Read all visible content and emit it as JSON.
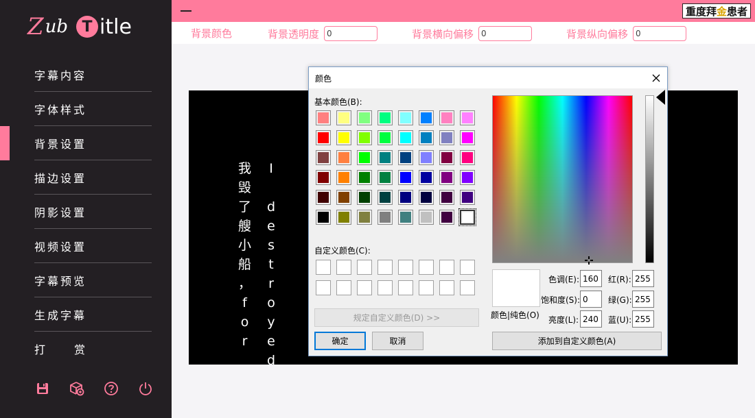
{
  "app": {
    "logo": {
      "z": "Z",
      "ub": "ub",
      "t": "T",
      "rest": "itle"
    },
    "watermark": {
      "pre": "重度",
      "mid": "拜",
      "gold": "金",
      "post": "患者"
    }
  },
  "sidebar": {
    "items": [
      {
        "label": "字幕内容"
      },
      {
        "label": "字体样式"
      },
      {
        "label": "背景设置",
        "active": true
      },
      {
        "label": "描边设置"
      },
      {
        "label": "阴影设置"
      },
      {
        "label": "视频设置"
      },
      {
        "label": "字幕预览"
      },
      {
        "label": "生成字幕"
      },
      {
        "label": "打赏"
      }
    ],
    "tools": [
      "save-icon",
      "package-icon",
      "help-icon",
      "power-icon"
    ],
    "accent": "#ff7b9c",
    "background": "#231f23"
  },
  "background_settings": {
    "color_label": "背景颜色",
    "opacity_label": "背景透明度",
    "opacity_value": "0",
    "x_offset_label": "背景横向偏移",
    "x_offset_value": "0",
    "y_offset_label": "背景纵向偏移",
    "y_offset_value": "0"
  },
  "preview": {
    "col1": [
      "我",
      "毁",
      "了",
      "艘",
      "小",
      "船",
      "，",
      "f",
      "o",
      "r"
    ],
    "col2": [
      "I",
      "",
      "d",
      "e",
      "s",
      "t",
      "r",
      "o",
      "y",
      "e",
      "d"
    ]
  },
  "color_dialog": {
    "title": "颜色",
    "basic_label": "基本颜色(B):",
    "basic_colors": [
      "#ff8080",
      "#ffff80",
      "#80ff80",
      "#00ff80",
      "#80ffff",
      "#0080ff",
      "#ff80c0",
      "#ff80ff",
      "#ff0000",
      "#ffff00",
      "#80ff00",
      "#00ff40",
      "#00ffff",
      "#0080c0",
      "#8080c0",
      "#ff00ff",
      "#804040",
      "#ff8040",
      "#00ff00",
      "#008080",
      "#004080",
      "#8080ff",
      "#800040",
      "#ff0080",
      "#800000",
      "#ff8000",
      "#008000",
      "#008040",
      "#0000ff",
      "#0000a0",
      "#800080",
      "#8000ff",
      "#400000",
      "#804000",
      "#004000",
      "#004040",
      "#000080",
      "#000040",
      "#400040",
      "#400080",
      "#000000",
      "#808000",
      "#808040",
      "#808080",
      "#408080",
      "#c0c0c0",
      "#400040",
      "#ffffff"
    ],
    "custom_label": "自定义颜色(C):",
    "define_custom_button": "规定自定义颜色(D) >>",
    "ok_button": "确定",
    "cancel_button": "取消",
    "color_solid_label": "颜色|纯色(O)",
    "hue_label": "色调(E):",
    "hue_value": "160",
    "sat_label": "饱和度(S):",
    "sat_value": "0",
    "lum_label": "亮度(L):",
    "lum_value": "240",
    "red_label": "红(R):",
    "red_value": "255",
    "green_label": "绿(G):",
    "green_value": "255",
    "blue_label": "蓝(U):",
    "blue_value": "255",
    "add_custom_button": "添加到自定义颜色(A)"
  }
}
